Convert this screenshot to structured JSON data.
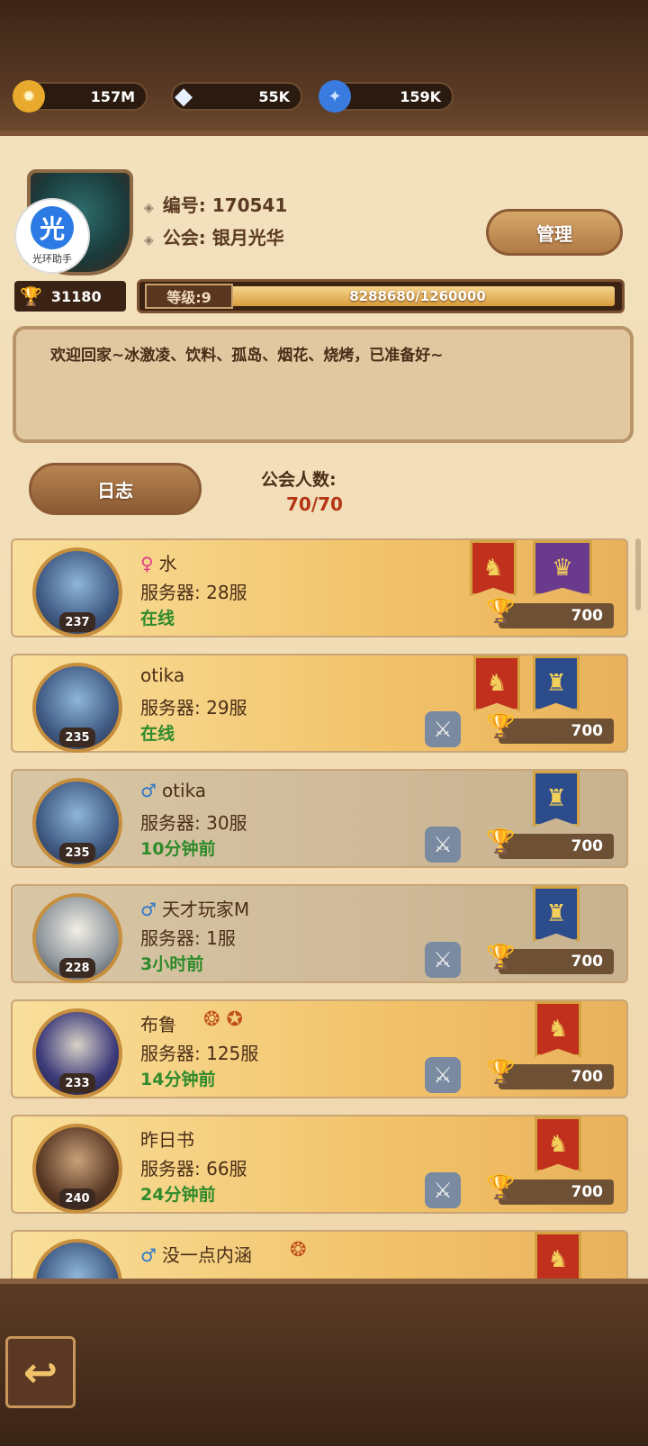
{
  "resources": [
    {
      "icon": "gold-coin-icon",
      "value": "157M"
    },
    {
      "icon": "diamond-icon",
      "value": "55K"
    },
    {
      "icon": "crystal-icon",
      "value": "159K"
    }
  ],
  "helper": {
    "glyph": "光",
    "text": "光环助手"
  },
  "guild": {
    "id_label": "编号: 170541",
    "name_label": "公会: 银月光华",
    "manage_label": "管理",
    "trophies": "31180",
    "level_label": "等级:9",
    "exp_text": "8288680/1260000",
    "notice": "欢迎回家~冰激凌、饮料、孤岛、烟花、烧烤，已准备好~",
    "log_label": "日志",
    "members_label": "公会人数:",
    "members_count": "70/70"
  },
  "members": [
    {
      "gender": "♀",
      "name": "水",
      "server": "服务器: 28服",
      "status": "在线",
      "level": "237",
      "trophies": "700"
    },
    {
      "gender": "",
      "name": "otika",
      "server": "服务器: 29服",
      "status": "在线",
      "level": "235",
      "trophies": "700"
    },
    {
      "gender": "♂",
      "name": "otika",
      "server": "服务器: 30服",
      "status": "10分钟前",
      "level": "235",
      "trophies": "700"
    },
    {
      "gender": "♂",
      "name": "天才玩家M",
      "server": "服务器: 1服",
      "status": "3小时前",
      "level": "228",
      "trophies": "700"
    },
    {
      "gender": "",
      "name": "布鲁",
      "server": "服务器: 125服",
      "status": "14分钟前",
      "level": "233",
      "trophies": "700"
    },
    {
      "gender": "",
      "name": "昨日书",
      "server": "服务器: 66服",
      "status": "24分钟前",
      "level": "240",
      "trophies": "700"
    },
    {
      "gender": "♂",
      "name": "没一点内涵",
      "server": "",
      "status": "",
      "level": "",
      "trophies": ""
    }
  ],
  "colors": {
    "accent": "#c0301d",
    "online": "#2f8a2b",
    "panel": "#f3e1bd"
  }
}
